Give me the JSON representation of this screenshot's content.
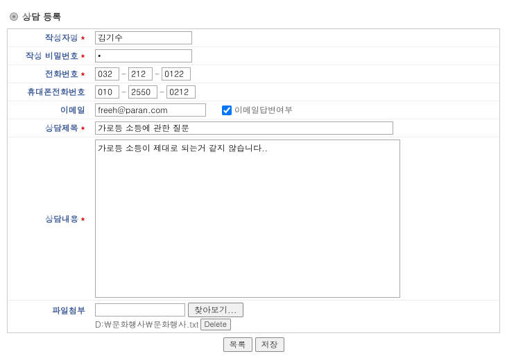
{
  "header": {
    "title": "상담 등록"
  },
  "form": {
    "author": {
      "label": "작성자명",
      "value": "김기수"
    },
    "password": {
      "label": "작성 비밀번호",
      "value": "*"
    },
    "phone": {
      "label": "전화번호",
      "p1": "032",
      "p2": "212",
      "p3": "0122"
    },
    "mobile": {
      "label": "휴대폰전화번호",
      "p1": "010",
      "p2": "2550",
      "p3": "0212"
    },
    "email": {
      "label": "이메일",
      "value": "freeh@paran.com",
      "replyLabel": "이메일답변여부"
    },
    "subject": {
      "label": "상담제목",
      "value": "가로등 소등에 관한 질문"
    },
    "content": {
      "label": "상담내용",
      "value": "가로등 소등이 제대로 되는거 같지 않습니다.."
    },
    "attachment": {
      "label": "파일첨부",
      "browseLabel": "찾아보기...",
      "filePath": "D:\\문화행사\\문화행사.txt",
      "deleteLabel": "Delete"
    }
  },
  "buttons": {
    "list": "목록",
    "save": "저장"
  }
}
